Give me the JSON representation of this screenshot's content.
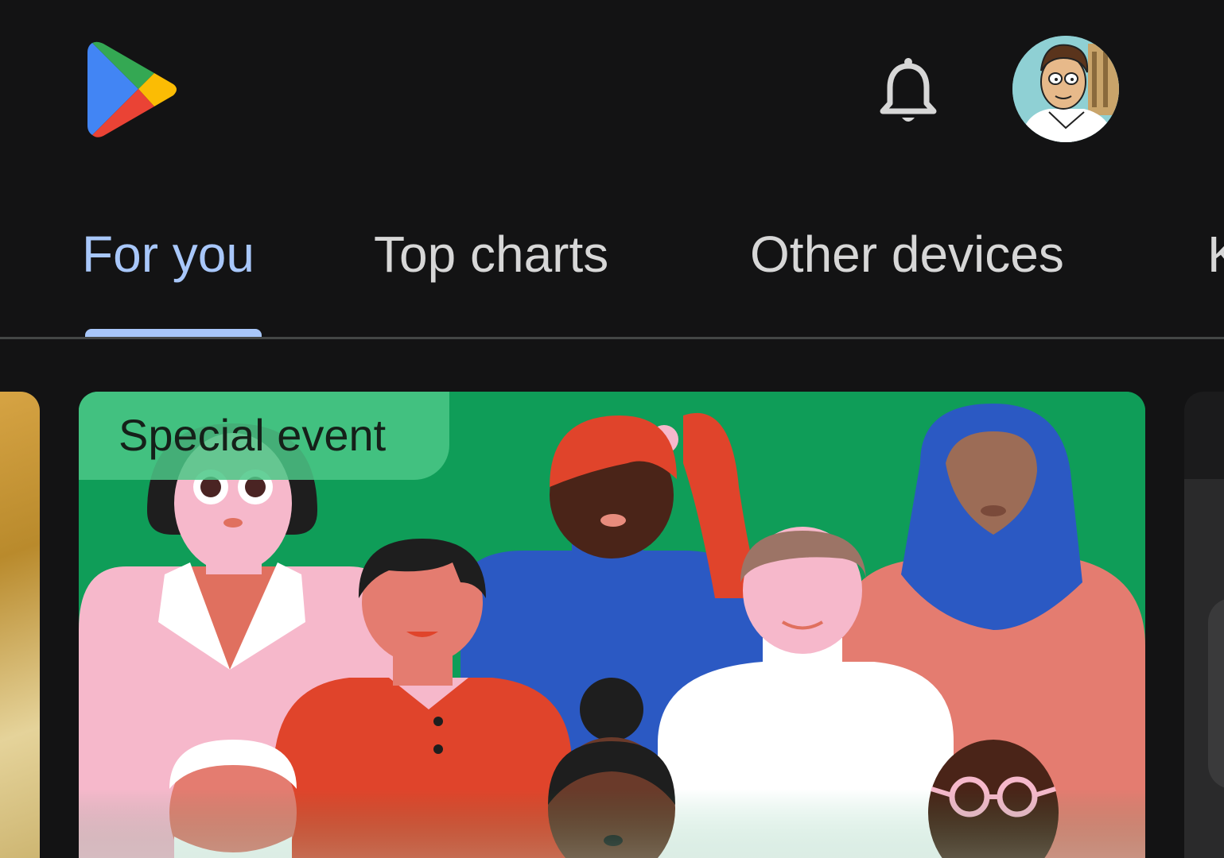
{
  "header": {
    "logo_icon": "google-play-logo",
    "notifications_icon": "bell-icon",
    "avatar_icon": "cartoon-avatar"
  },
  "tabs": [
    {
      "label": "For you",
      "active": true
    },
    {
      "label": "Top charts",
      "active": false
    },
    {
      "label": "Other devices",
      "active": false
    },
    {
      "label": "K",
      "active": false
    }
  ],
  "featured": {
    "badge": "Special event"
  },
  "colors": {
    "background": "#131314",
    "accent": "#a8c7fa",
    "tab_text": "#d7d7d7",
    "card_green": "#0f9d58"
  }
}
